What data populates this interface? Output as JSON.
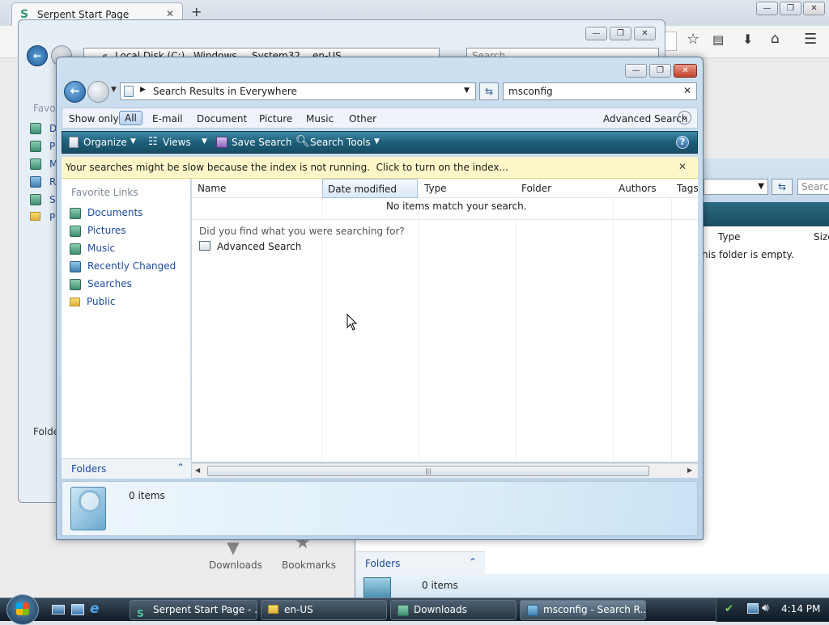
{
  "browser": {
    "tab_title": "Serpent Start Page",
    "new_tab_symbol": "+",
    "launcher_downloads": "Downloads",
    "launcher_bookmarks": "Bookmarks"
  },
  "background_explorer": {
    "address": [
      "«",
      "Local Disk (C:)",
      "Windows",
      "System32",
      "en-US"
    ],
    "search_placeholder": "Search",
    "sidebar_header": "Favo",
    "sidebar_letters": [
      "D",
      "P",
      "M",
      "R",
      "S",
      "P"
    ],
    "folders_label": "Folde"
  },
  "second_explorer": {
    "search_placeholder": "Search",
    "col_type": "Type",
    "col_size": "Size",
    "empty_text": "his folder is empty.",
    "folders_label": "Folders",
    "item_count": "0 items"
  },
  "window": {
    "address": "Search Results in Everywhere",
    "search_value": "msconfig",
    "filter_label": "Show only:",
    "filters": [
      "All",
      "E-mail",
      "Document",
      "Picture",
      "Music",
      "Other"
    ],
    "active_filter": "All",
    "advanced_search": "Advanced Search",
    "toolbar": {
      "organize": "Organize",
      "views": "Views",
      "save_search": "Save Search",
      "search_tools": "Search Tools",
      "help": "?"
    },
    "info_bar": "Your searches might be slow because the index is not running.  Click to turn on the index...",
    "favorite_links_header": "Favorite Links",
    "favorite_links": [
      "Documents",
      "Pictures",
      "Music",
      "Recently Changed",
      "Searches",
      "Public"
    ],
    "columns": [
      "Name",
      "Date modified",
      "Type",
      "Folder",
      "Authors",
      "Tags"
    ],
    "no_items": "No items match your search.",
    "did_you_find": "Did you find what you were searching for?",
    "advanced_search_link": "Advanced Search",
    "folders_label": "Folders",
    "details_count": "0 items"
  },
  "taskbar": {
    "buttons": [
      "Serpent Start Page - ...",
      "en-US",
      "Downloads",
      "msconfig - Search R..."
    ],
    "clock": "4:14 PM"
  }
}
